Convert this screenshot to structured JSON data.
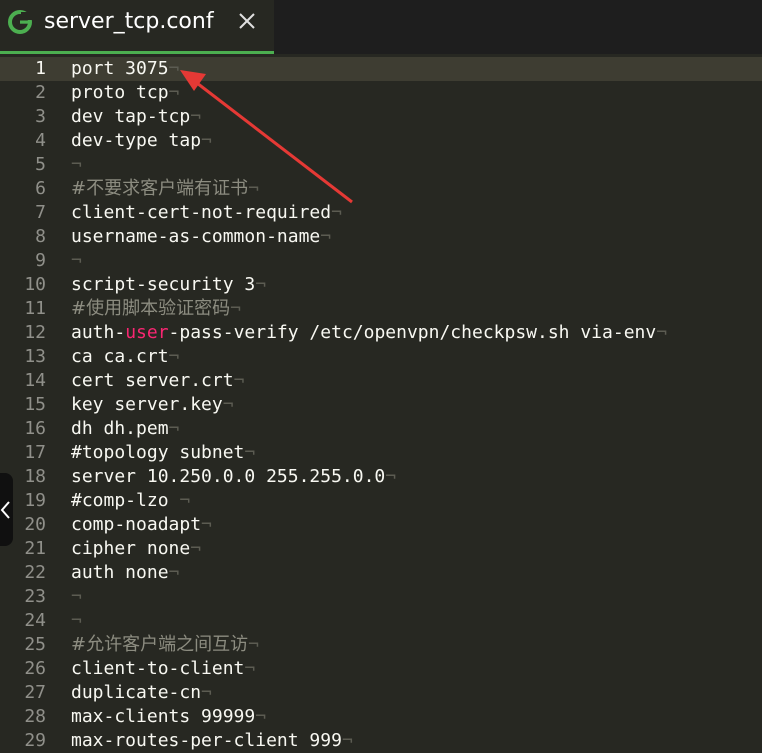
{
  "tab": {
    "title": "server_tcp.conf",
    "close_label": "×",
    "accent_color": "#4caf50"
  },
  "editor": {
    "newline_mark": "¬",
    "lines": [
      {
        "num": "1",
        "text": "port 3075"
      },
      {
        "num": "2",
        "text": "proto tcp"
      },
      {
        "num": "3",
        "text": "dev tap-tcp"
      },
      {
        "num": "4",
        "text": "dev-type tap"
      },
      {
        "num": "5",
        "text": ""
      },
      {
        "num": "6",
        "text": "#不要求客户端有证书"
      },
      {
        "num": "7",
        "text": "client-cert-not-required"
      },
      {
        "num": "8",
        "text": "username-as-common-name"
      },
      {
        "num": "9",
        "text": ""
      },
      {
        "num": "10",
        "text": "script-security 3"
      },
      {
        "num": "11",
        "text": "#使用脚本验证密码"
      },
      {
        "num": "12",
        "text": "auth-user-pass-verify /etc/openvpn/checkpsw.sh via-env"
      },
      {
        "num": "13",
        "text": "ca ca.crt"
      },
      {
        "num": "14",
        "text": "cert server.crt"
      },
      {
        "num": "15",
        "text": "key server.key"
      },
      {
        "num": "16",
        "text": "dh dh.pem"
      },
      {
        "num": "17",
        "text": "#topology subnet"
      },
      {
        "num": "18",
        "text": "server 10.250.0.0 255.255.0.0"
      },
      {
        "num": "19",
        "text": "#comp-lzo "
      },
      {
        "num": "20",
        "text": "comp-noadapt"
      },
      {
        "num": "21",
        "text": "cipher none"
      },
      {
        "num": "22",
        "text": "auth none"
      },
      {
        "num": "23",
        "text": ""
      },
      {
        "num": "24",
        "text": ""
      },
      {
        "num": "25",
        "text": "#允许客户端之间互访"
      },
      {
        "num": "26",
        "text": "client-to-client"
      },
      {
        "num": "27",
        "text": "duplicate-cn"
      },
      {
        "num": "28",
        "text": "max-clients 99999"
      },
      {
        "num": "29",
        "text": "max-routes-per-client 999"
      }
    ]
  },
  "colors": {
    "background": "#272822",
    "current_line": "#3e3d32",
    "text": "#f8f8f2",
    "keyword": "#f92672",
    "gutter": "#90908a",
    "cn_comment": "#8c8c80",
    "annotation_arrow": "#e53935"
  },
  "icons": {
    "app_logo": "g-logo-icon",
    "close": "close-icon",
    "side_handle": "chevron-left-icon"
  }
}
